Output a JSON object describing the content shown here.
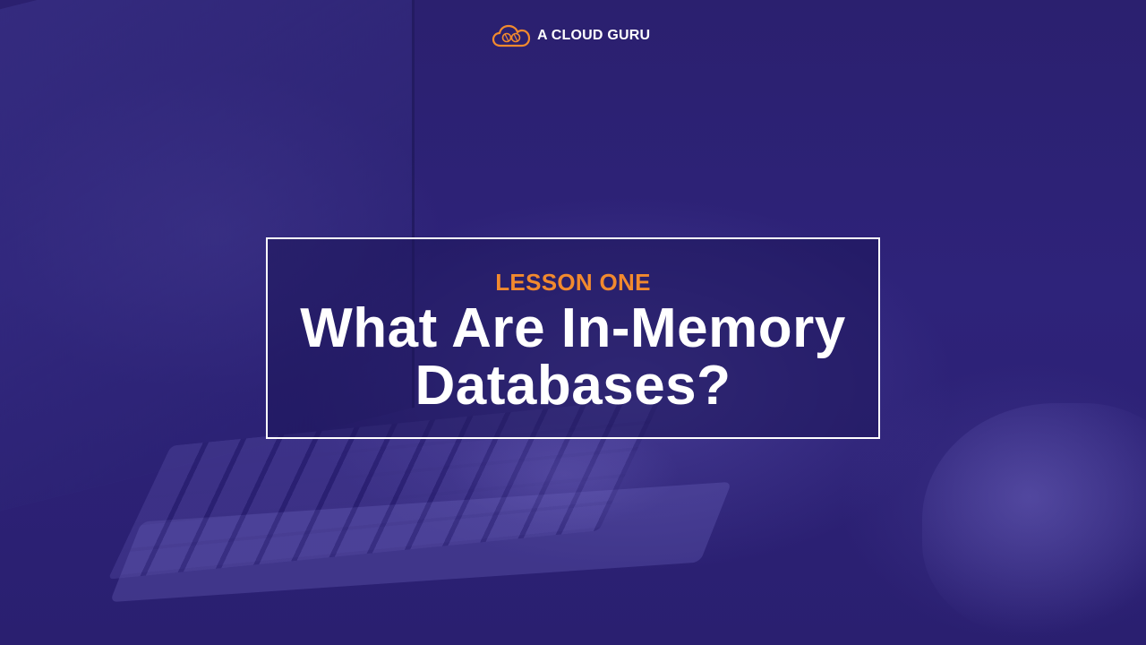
{
  "brand": {
    "name": "A CLOUD GURU",
    "icon": "cloud-logo-icon",
    "accent_color": "#f28a2e"
  },
  "slide": {
    "kicker": "LESSON ONE",
    "title_line1": "What Are In-Memory",
    "title_line2": "Databases?"
  },
  "colors": {
    "background": "#2a1f6e",
    "title_text": "#ffffff",
    "kicker_text": "#f28a2e",
    "frame_border": "#ffffff"
  }
}
